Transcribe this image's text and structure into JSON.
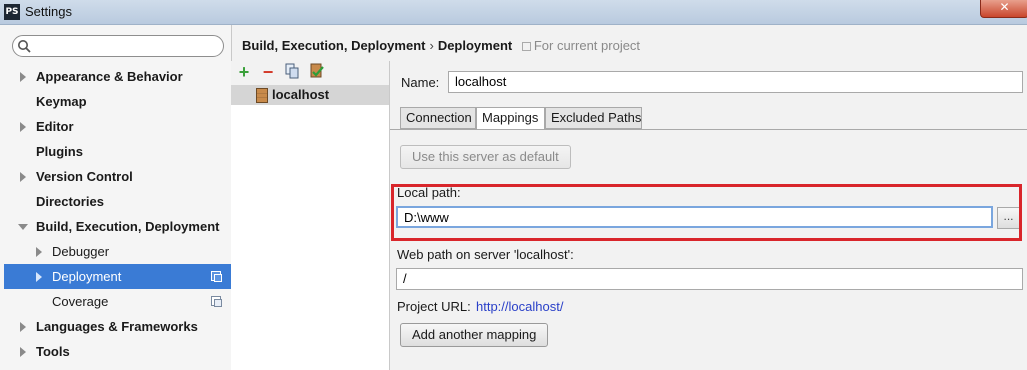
{
  "window": {
    "title": "Settings",
    "app_icon_text": "PS",
    "close_symbol": "✕"
  },
  "search": {
    "value": ""
  },
  "sidebar": {
    "items": [
      {
        "label": "Appearance & Behavior"
      },
      {
        "label": "Keymap"
      },
      {
        "label": "Editor"
      },
      {
        "label": "Plugins"
      },
      {
        "label": "Version Control"
      },
      {
        "label": "Directories"
      },
      {
        "label": "Build, Execution, Deployment"
      },
      {
        "label": "Debugger"
      },
      {
        "label": "Deployment"
      },
      {
        "label": "Coverage"
      },
      {
        "label": "Languages & Frameworks"
      },
      {
        "label": "Tools"
      }
    ],
    "selected": "Deployment"
  },
  "breadcrumb": {
    "parent": "Build, Execution, Deployment",
    "separator": "›",
    "current": "Deployment",
    "note": "For current project"
  },
  "servers": {
    "toolbar": {
      "add": "+",
      "remove": "−"
    },
    "list": [
      {
        "label": "localhost"
      }
    ]
  },
  "form": {
    "name_label": "Name:",
    "name_value": "localhost",
    "tabs": [
      {
        "label": "Connection"
      },
      {
        "label": "Mappings"
      },
      {
        "label": "Excluded Paths"
      }
    ],
    "active_tab": "Mappings",
    "default_button": "Use this server as default",
    "local_path_label": "Local path:",
    "local_path_value": "D:\\www",
    "browse_label": "...",
    "web_path_label": "Web path on server 'localhost':",
    "web_path_value": "/",
    "project_url_label": "Project URL:",
    "project_url_value": "http://localhost/",
    "add_mapping_button": "Add another mapping"
  },
  "colors": {
    "selection": "#3a7bd5",
    "highlight": "#d9262b",
    "link": "#2a40c8"
  }
}
